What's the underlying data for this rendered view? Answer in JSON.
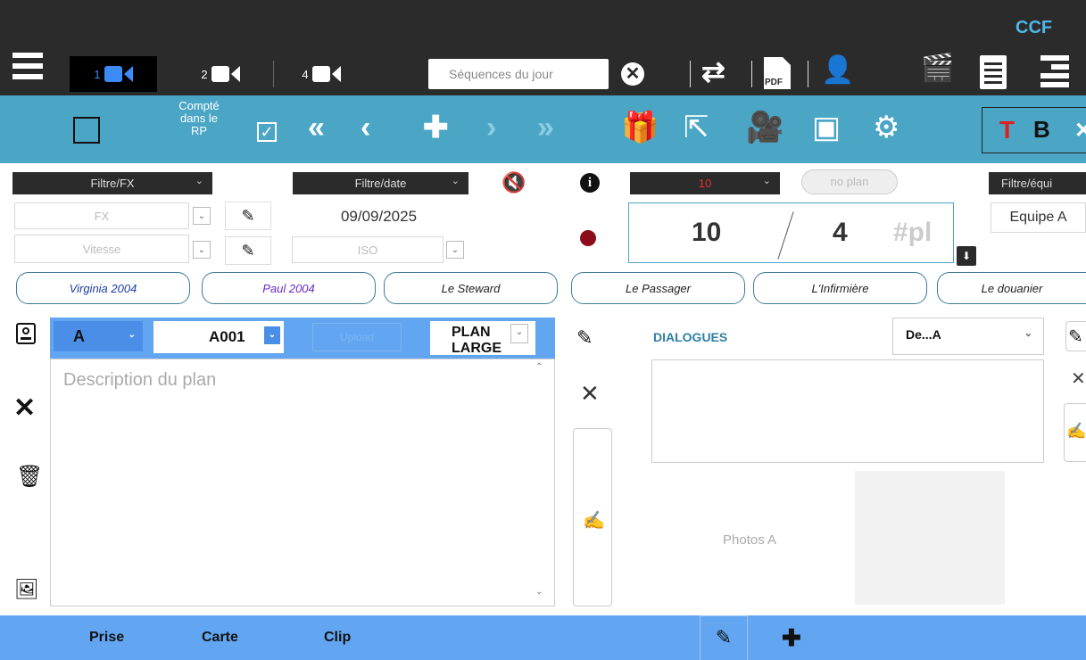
{
  "topbar": {
    "ccf": "CCF",
    "cams": [
      {
        "num": "1"
      },
      {
        "num": "2"
      },
      {
        "num": "4"
      }
    ],
    "search_placeholder": "Séquences du jour"
  },
  "toolbar": {
    "compte": "Compté dans le RP",
    "compte_lines": [
      "Compté",
      "dans le",
      "RP"
    ],
    "T": "T",
    "B": "B"
  },
  "filters": {
    "fx": "Filtre/FX",
    "date": "Filtre/date",
    "num": "10",
    "noplan": "no plan",
    "equipe": "Filtre/équi",
    "fx_field": "FX",
    "vitesse": "Vitesse",
    "date_value": "09/09/2025",
    "iso": "ISO",
    "equipe_value": "Equipe A",
    "counter_a": "10",
    "counter_b": "4",
    "counter_pl": "#pl"
  },
  "characters": [
    "Virginia 2004",
    "Paul 2004",
    "Le Steward",
    "Le Passager",
    "L'Infirmière",
    "Le douanier"
  ],
  "plan": {
    "letter": "A",
    "code": "A001",
    "upload": "Upload",
    "type": "PLAN LARGE",
    "description_placeholder": "Description du plan"
  },
  "dialogues": {
    "title": "DIALOGUES",
    "select": "De...A",
    "photos": "Photos A"
  },
  "bottom": {
    "prise": "Prise",
    "carte": "Carte",
    "clip": "Clip"
  },
  "colors": {
    "topbar": "#2b2b2b",
    "toolbar": "#4ba6c6",
    "accent": "#62a6f2",
    "record": "#8b0d1a"
  }
}
